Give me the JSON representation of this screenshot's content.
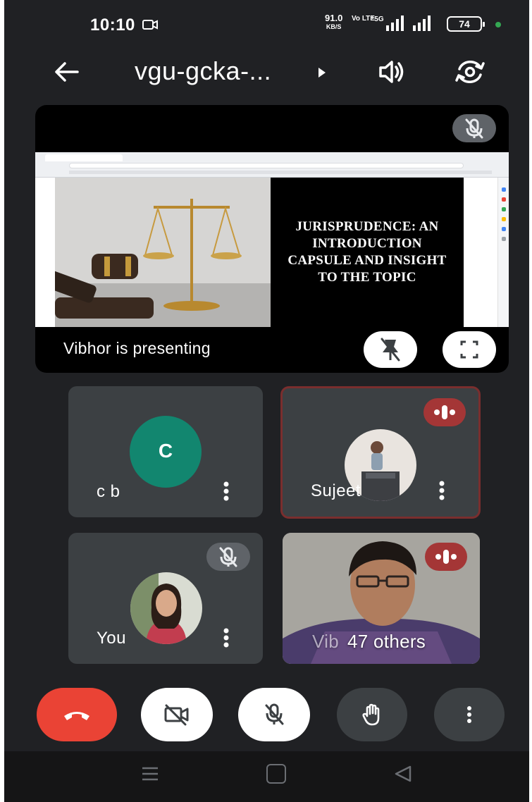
{
  "status_bar": {
    "time": "10:10",
    "net_speed": "91.0",
    "net_speed_unit": "KB/S",
    "volte_label": "Vo LTE",
    "network_label": "5G",
    "battery_level": "74",
    "indicator_color": "#34a853"
  },
  "header": {
    "meeting_title": "vgu-gcka-...",
    "icons": [
      "back-arrow-icon",
      "speaker-icon",
      "switch-camera-icon"
    ]
  },
  "presentation": {
    "slide_title": "JURISPRUDENCE: AN INTRODUCTION CAPSULE AND INSIGHT TO THE TOPIC",
    "presenter_label": "Vibhor is presenting",
    "icons": [
      "mic-off-icon",
      "unpin-icon",
      "fullscreen-icon"
    ]
  },
  "participants": [
    {
      "name": "c b",
      "avatar_letter": "C",
      "avatar_color": "#12866f",
      "state": "normal"
    },
    {
      "name": "Sujeet",
      "state": "speaking",
      "highlight_color": "#7a2e2e"
    },
    {
      "name": "You",
      "state": "muted"
    },
    {
      "name": "Vib",
      "overflow_label": "47 others",
      "state": "speaking"
    }
  ],
  "controls": {
    "end_call_color": "#ea4335",
    "buttons": [
      "end-call",
      "camera-off",
      "mic-off",
      "raise-hand",
      "more-options"
    ]
  },
  "nav_bar": {
    "buttons": [
      "recent-apps",
      "home",
      "back"
    ]
  }
}
